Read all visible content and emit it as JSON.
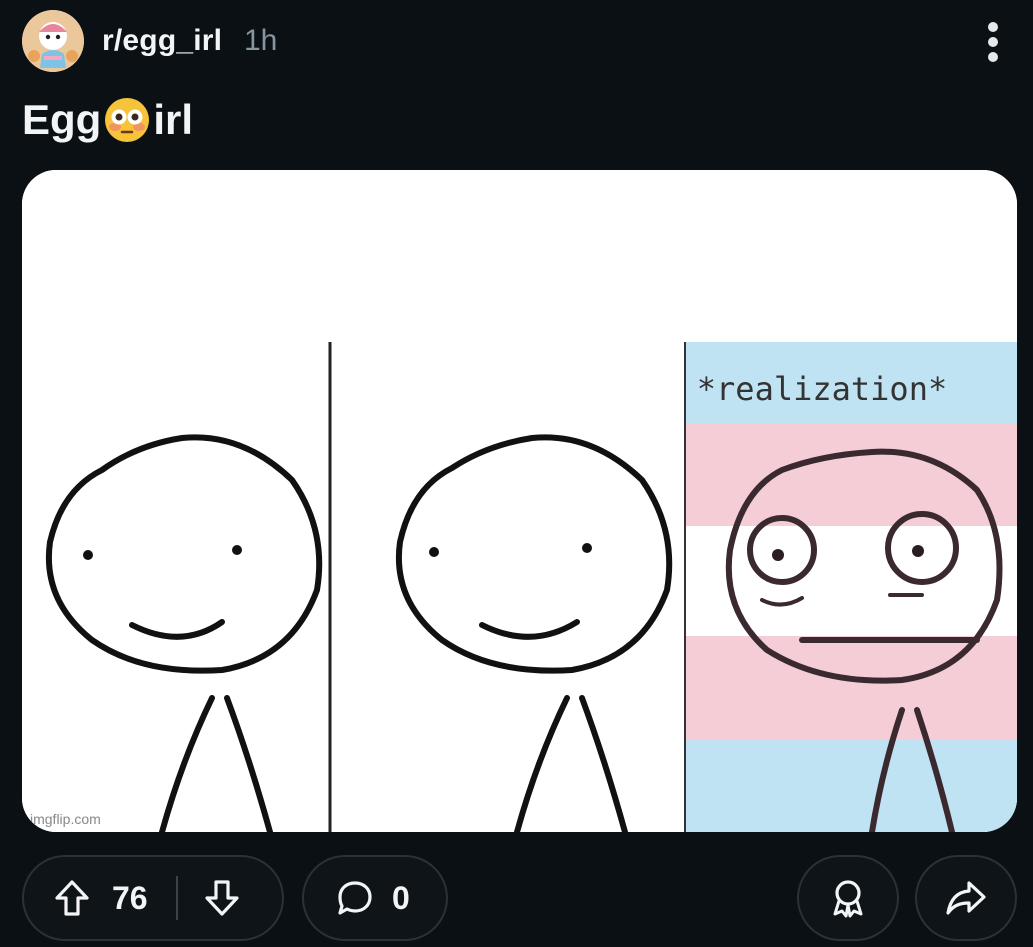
{
  "post": {
    "subreddit": "r/egg_irl",
    "age": "1h",
    "title_part1": "Egg",
    "title_emoji": "flushed-face-emoji",
    "title_part2": "irl"
  },
  "meme": {
    "caption": "*realization*",
    "watermark": "imgflip.com",
    "flag_colors": {
      "blue": "#bfe3f2",
      "pink": "#f4cdd6",
      "white": "#ffffff"
    }
  },
  "actions": {
    "upvotes": "76",
    "comments": "0"
  },
  "icons": {
    "upvote": "arrow-up-icon",
    "downvote": "arrow-down-icon",
    "comment": "comment-bubble-icon",
    "award": "award-icon",
    "share": "share-icon",
    "more": "more-vertical-icon"
  }
}
